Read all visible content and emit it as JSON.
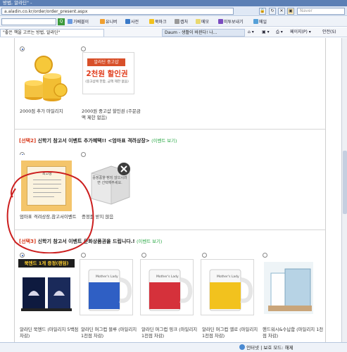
{
  "browser": {
    "title": "방법, 알라딘\" -",
    "url": "a.aladin.co.kr/order/order_present.aspx",
    "search_placeholder": "Naver",
    "toolbar": [
      "가베블이",
      "유니버",
      "사전",
      "북마크",
      "캡처",
      "메모",
      "미투보내기",
      "메일"
    ],
    "tab_active": "\"좋은 책을 고르는 방법, 알라딘\"",
    "tab_other": "Daum - 생활이 바뀐다! 나...",
    "right_menu": [
      "페이지(P) ▾",
      "안전(S)"
    ],
    "status": "인터넷 | 보호 모드: 해제"
  },
  "section1": {
    "items": [
      {
        "caption": "2000점 추가 마일리지",
        "selected": true
      },
      {
        "caption": "2000원 중고샵 할인권 (주문금액 제한 없음)",
        "selected": false
      }
    ],
    "coupon": {
      "header": "알라딘 중고샵",
      "big": "2천원 할인권",
      "small": "(중고샵에 한함, 금액 제한 없음)"
    }
  },
  "section2": {
    "tag": "[선택2]",
    "title": "신학기 참고서 이벤트 추가혜택!! <엄마표 격려상장>",
    "event_link": "(이벤트 보기)",
    "items": [
      {
        "caption": "엄마표 격려상장,참고서이벤트",
        "selected": true
      },
      {
        "caption": "증정품 받지 않음",
        "selected": false
      }
    ],
    "cert_title": "최고상",
    "nogift_msg": "증정품을 받지 않으시려면 선택해주세요."
  },
  "section3": {
    "tag": "[선택3]",
    "title": "신학기 참고서 이벤트 문화상품권을 드립니다.!",
    "event_link": "(이벤트 보기)",
    "bookmark_badge": "북엔드 1개 증정(랜덤)",
    "mug_label": "Mother's Lady",
    "items": [
      {
        "caption": "알라딘 북엔드 (마일리지 5백점 차감)",
        "selected": true,
        "color": "#1a2a5a"
      },
      {
        "caption": "알라딘 머그컵 블루 (마일리지 1천점 차감)",
        "selected": false,
        "color": "#2f5fc4"
      },
      {
        "caption": "알라딘 머그컵 핑크 (마일리지 1천점 차감)",
        "selected": false,
        "color": "#d5313b"
      },
      {
        "caption": "알라딘 머그컵 옐로 (마일리지 1천점 차감)",
        "selected": false,
        "color": "#f2c21e"
      },
      {
        "caption": "핸드워시&수납함 (마일리지 1천점 차감)",
        "selected": false,
        "color": "#9fc3dc"
      }
    ]
  },
  "colors": {
    "accent_red": "#d83a1c",
    "event_green": "#2aa845",
    "chrome_blue": "#5b7fb5",
    "scribble": "#cc1f1f"
  }
}
